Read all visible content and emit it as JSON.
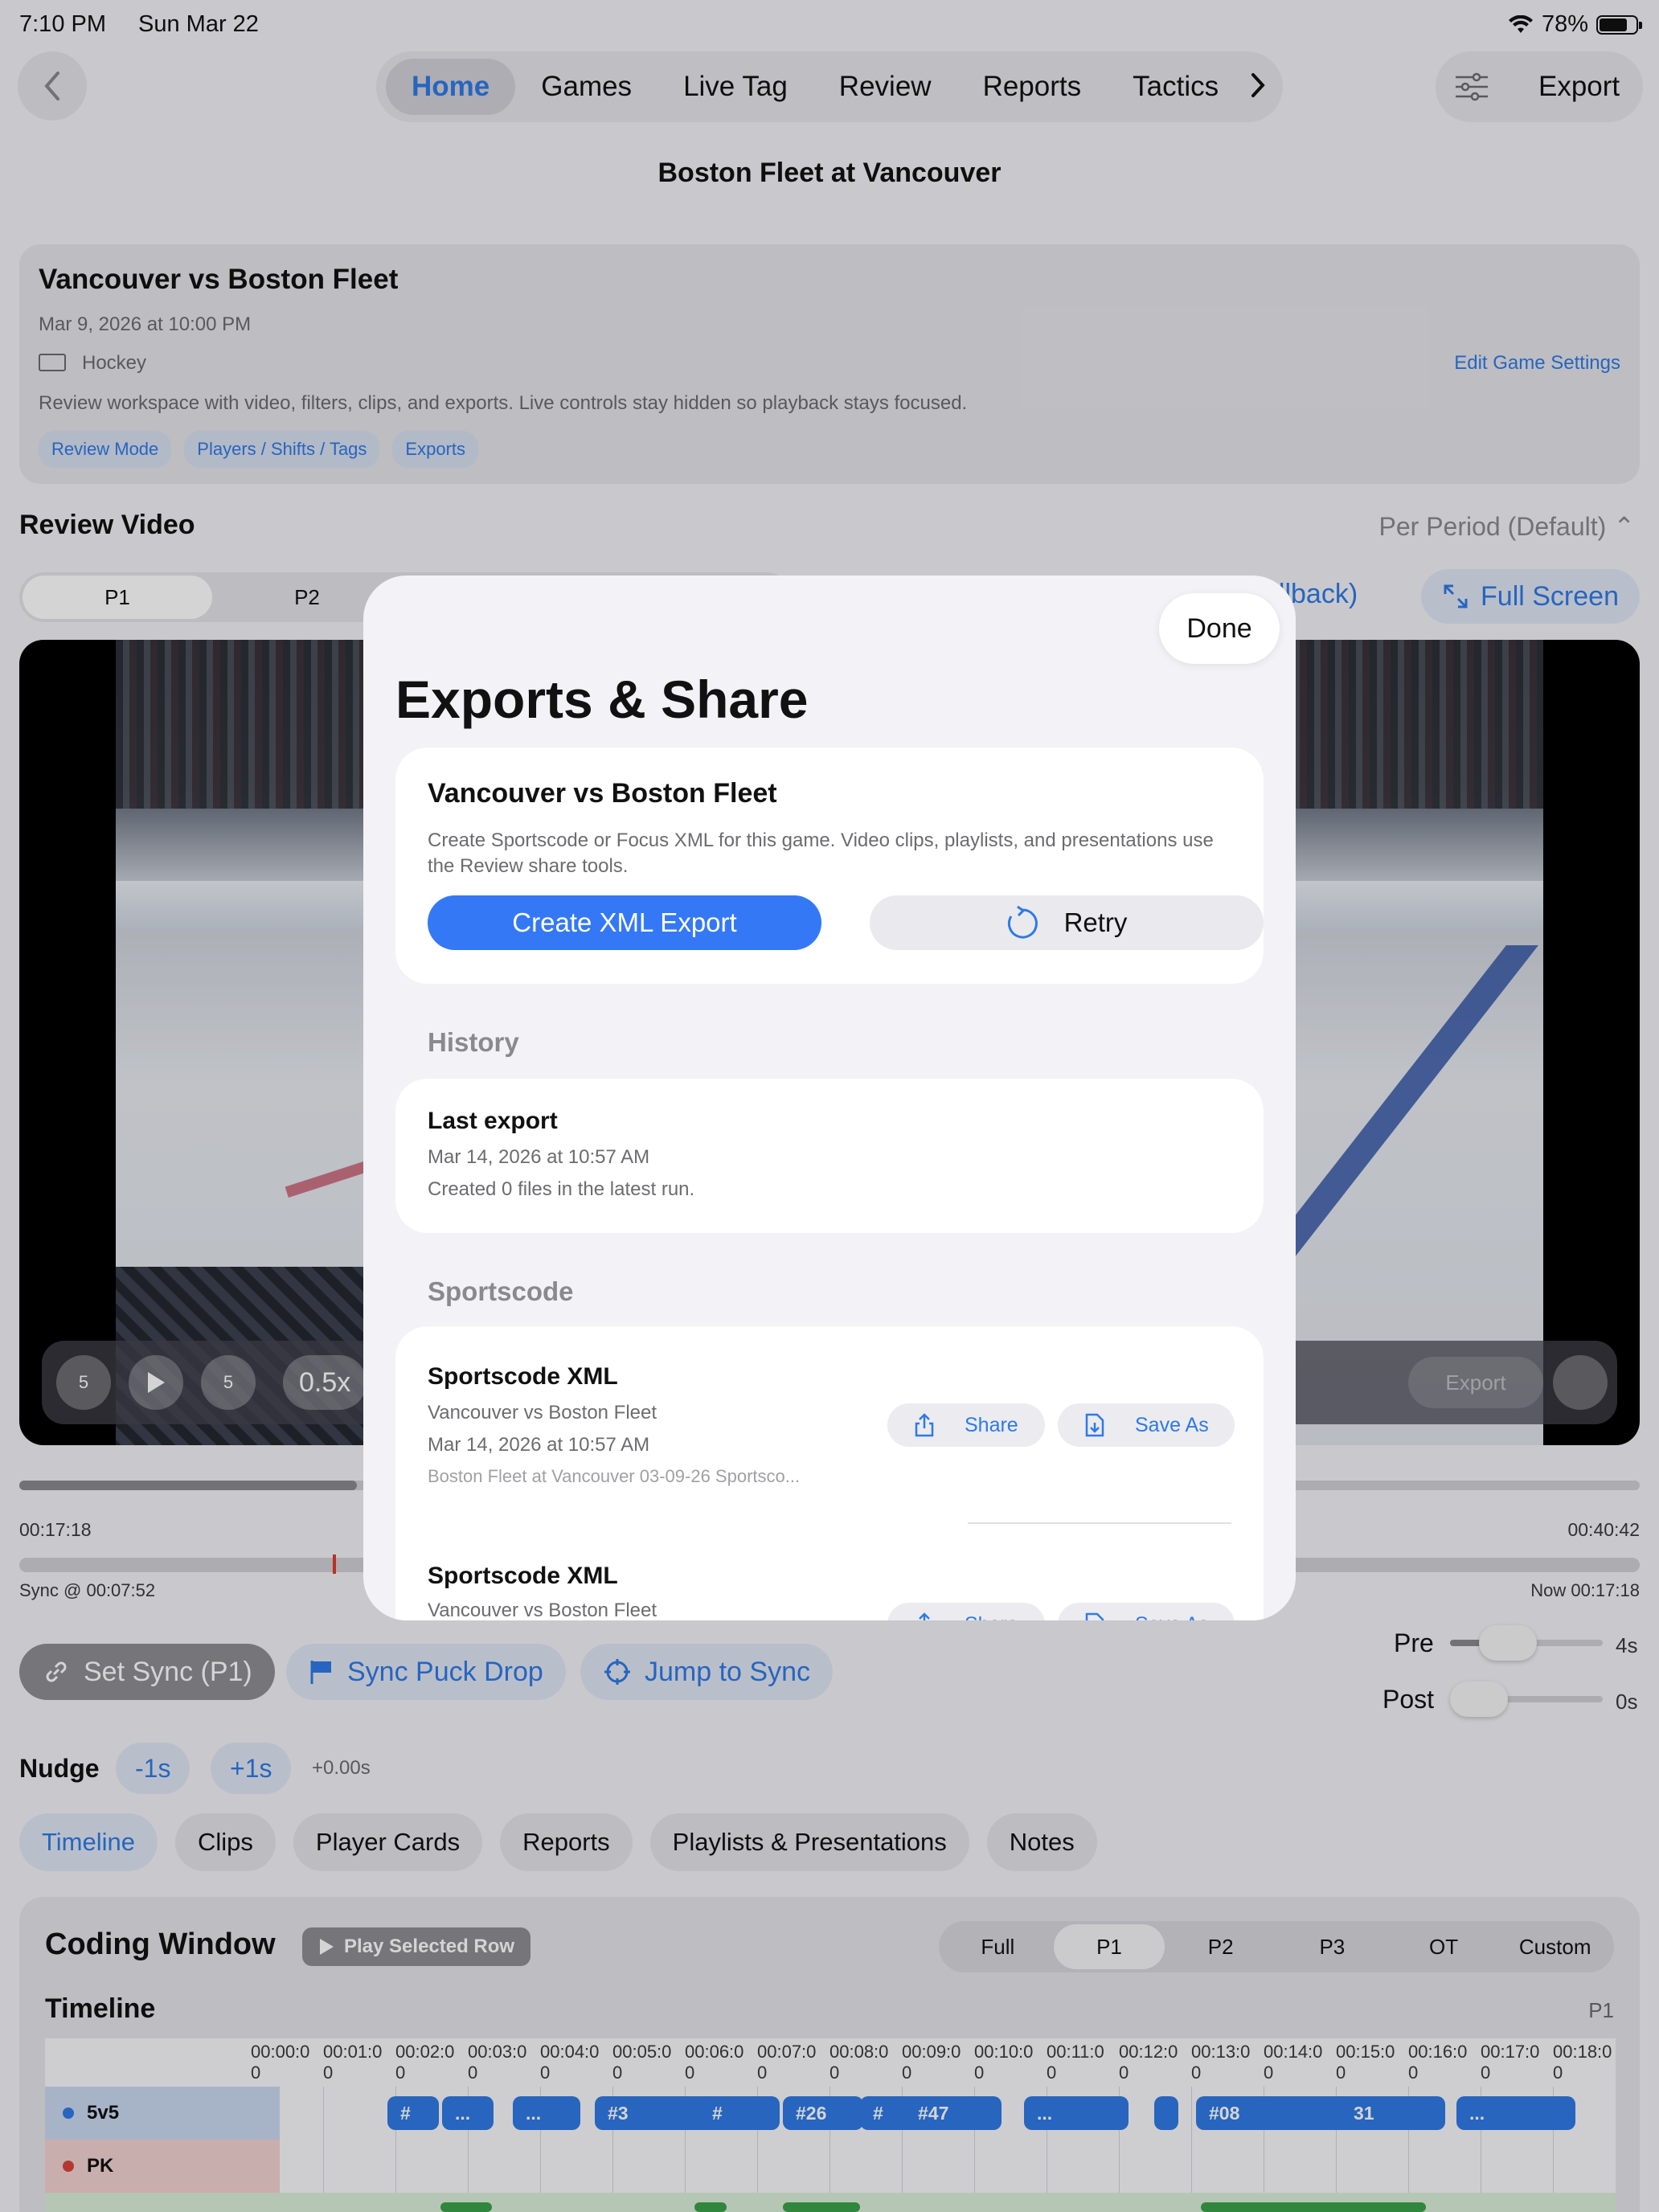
{
  "status": {
    "time": "7:10 PM",
    "date": "Sun Mar 22",
    "battery": "78%"
  },
  "nav": {
    "tabs": [
      "Home",
      "Games",
      "Live Tag",
      "Review",
      "Reports",
      "Tactics"
    ],
    "active_tab": "Home",
    "export_label": "Export"
  },
  "page_title": "Boston Fleet at Vancouver",
  "game": {
    "title": "Vancouver vs Boston Fleet",
    "date": "Mar 9, 2026 at 10:00 PM",
    "sport": "Hockey",
    "edit_link": "Edit Game Settings",
    "description": "Review workspace with video, filters, clips, and exports. Live controls stay hidden so playback stays focused.",
    "chips": [
      "Review Mode",
      "Players / Shifts / Tags",
      "Exports"
    ]
  },
  "review": {
    "title": "Review Video",
    "per_period": "Per Period (Default)",
    "periods": [
      "P1",
      "P2"
    ],
    "fallback_text": "allback)",
    "full_screen": "Full Screen",
    "speed": "0.5x",
    "skip_back": "5",
    "skip_fwd": "5",
    "export_mini": "Export",
    "time_start": "00:17:18",
    "time_end": "00:40:42",
    "sync_at": "Sync @ 00:07:52",
    "now": "Now 00:17:18"
  },
  "sync": {
    "set_sync": "Set Sync (P1)",
    "sync_puck": "Sync Puck Drop",
    "jump_sync": "Jump to Sync",
    "pre_label": "Pre",
    "pre_value": "4s",
    "post_label": "Post",
    "post_value": "0s"
  },
  "nudge": {
    "label": "Nudge",
    "minus": "-1s",
    "plus": "+1s",
    "value": "+0.00s"
  },
  "bottom_tabs": [
    "Timeline",
    "Clips",
    "Player Cards",
    "Reports",
    "Playlists & Presentations",
    "Notes"
  ],
  "coding": {
    "title": "Coding Window",
    "play_selected": "Play Selected Row",
    "ranges": [
      "Full",
      "P1",
      "P2",
      "P3",
      "OT",
      "Custom"
    ],
    "active_range": "P1",
    "timeline_title": "Timeline",
    "timeline_period": "P1",
    "ticks": [
      "00:00:0\n0",
      "00:01:0\n0",
      "00:02:0\n0",
      "00:03:0\n0",
      "00:04:0\n0",
      "00:05:0\n0",
      "00:06:0\n0",
      "00:07:0\n0",
      "00:08:0\n0",
      "00:09:0\n0",
      "00:10:0\n0",
      "00:11:0\n0",
      "00:12:0\n0",
      "00:13:0\n0",
      "00:14:0\n0",
      "00:15:0\n0",
      "00:16:0\n0",
      "00:17:0\n0",
      "00:18:0\n0"
    ],
    "rows": [
      {
        "label": "5v5",
        "color": "#2f7ae5"
      },
      {
        "label": "PK",
        "color": "#d9443a"
      }
    ],
    "tags": [
      "#",
      "...",
      "...",
      "#3",
      "#",
      "#26",
      "#",
      "#47",
      "...",
      "#08",
      "31",
      "..."
    ]
  },
  "modal": {
    "done": "Done",
    "title": "Exports & Share",
    "card_title": "Vancouver vs Boston Fleet",
    "card_desc": "Create Sportscode or Focus XML for this game. Video clips, playlists, and presentations use the Review share tools.",
    "create_btn": "Create XML Export",
    "retry_btn": "Retry",
    "history_header": "History",
    "last_export_title": "Last export",
    "last_export_date": "Mar 14, 2026 at 10:57 AM",
    "last_export_files": "Created 0 files in the latest run.",
    "sportscode_header": "Sportscode",
    "items": [
      {
        "title": "Sportscode XML",
        "game": "Vancouver vs Boston Fleet",
        "date": "Mar 14, 2026 at 10:57 AM",
        "file": "Boston Fleet at Vancouver 03-09-26 Sportsco...",
        "share": "Share",
        "save_as": "Save As"
      },
      {
        "title": "Sportscode XML",
        "game": "Vancouver vs Boston Fleet",
        "share": "Share",
        "save_as": "Save As"
      }
    ]
  }
}
